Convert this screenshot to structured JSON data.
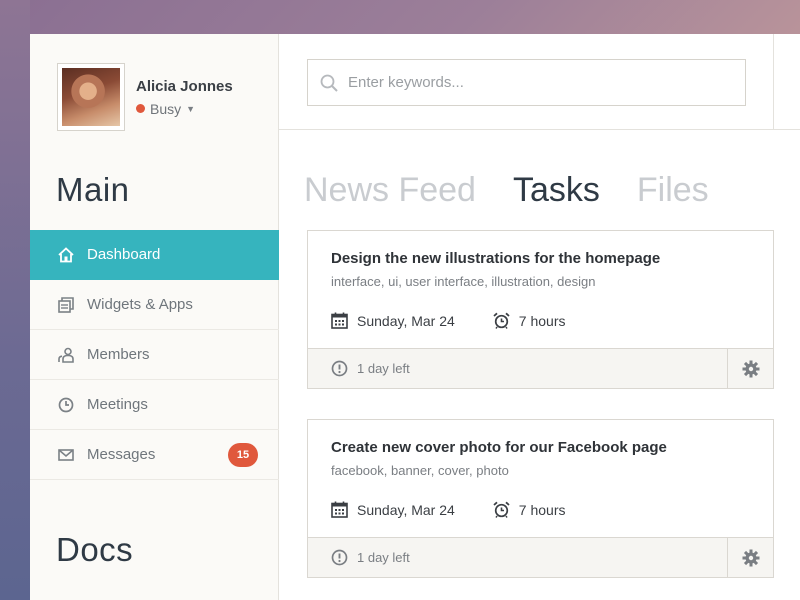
{
  "profile": {
    "name": "Alicia Jonnes",
    "status": "Busy",
    "status_color": "#e0583c"
  },
  "sidebar": {
    "section_main": "Main",
    "section_docs": "Docs",
    "items": [
      {
        "label": "Dashboard",
        "icon": "home-icon",
        "active": true
      },
      {
        "label": "Widgets & Apps",
        "icon": "widgets-icon"
      },
      {
        "label": "Members",
        "icon": "members-icon"
      },
      {
        "label": "Meetings",
        "icon": "clock-icon"
      },
      {
        "label": "Messages",
        "icon": "mail-icon",
        "badge": "15"
      }
    ]
  },
  "search": {
    "placeholder": "Enter keywords...",
    "value": ""
  },
  "tabs": [
    {
      "label": "News Feed",
      "active": false
    },
    {
      "label": "Tasks",
      "active": true
    },
    {
      "label": "Files",
      "active": false
    }
  ],
  "tasks": [
    {
      "title": "Design the new illustrations for the homepage",
      "tags": "interface, ui, user interface, illustration, design",
      "date": "Sunday, Mar 24",
      "duration": "7 hours",
      "remaining": "1 day left"
    },
    {
      "title": "Create new cover photo for our Facebook page",
      "tags": "facebook, banner, cover, photo",
      "date": "Sunday, Mar 24",
      "duration": "7 hours",
      "remaining": "1 day left"
    }
  ],
  "colors": {
    "accent": "#36b4be",
    "badge": "#e0583c"
  }
}
